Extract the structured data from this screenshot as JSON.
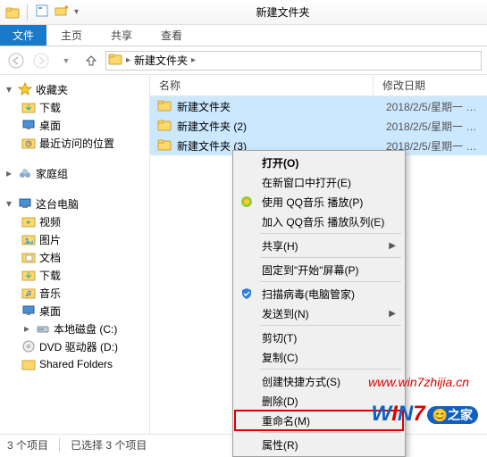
{
  "window": {
    "title": "新建文件夹"
  },
  "tabs": {
    "file": "文件",
    "home": "主页",
    "share": "共享",
    "view": "查看"
  },
  "address": {
    "root": "新建文件夹"
  },
  "columns": {
    "name": "名称",
    "date": "修改日期"
  },
  "files": [
    {
      "name": "新建文件夹",
      "date": "2018/2/5/星期一 …",
      "selected": true
    },
    {
      "name": "新建文件夹 (2)",
      "date": "2018/2/5/星期一 …",
      "selected": true
    },
    {
      "name": "新建文件夹 (3)",
      "date": "2018/2/5/星期一 …",
      "selected": true
    }
  ],
  "sidebar": {
    "favorites": "收藏夹",
    "downloads": "下载",
    "desktop": "桌面",
    "recent": "最近访问的位置",
    "homegroup": "家庭组",
    "thispc": "这台电脑",
    "videos": "视频",
    "pictures": "图片",
    "documents": "文档",
    "downloads2": "下载",
    "music": "音乐",
    "desktop2": "桌面",
    "localdisk": "本地磁盘 (C:)",
    "dvd": "DVD 驱动器 (D:)",
    "shared": "Shared Folders"
  },
  "status": {
    "items": "3 个项目",
    "selected": "已选择 3 个项目"
  },
  "ctx": {
    "open": "打开(O)",
    "open_new": "在新窗口中打开(E)",
    "qq_play": "使用 QQ音乐 播放(P)",
    "qq_queue": "加入 QQ音乐 播放队列(E)",
    "share": "共享(H)",
    "pin_start": "固定到\"开始\"屏幕(P)",
    "scan": "扫描病毒(电脑管家)",
    "send_to": "发送到(N)",
    "cut": "剪切(T)",
    "copy": "复制(C)",
    "shortcut": "创建快捷方式(S)",
    "delete": "删除(D)",
    "rename": "重命名(M)",
    "properties": "属性(R)"
  },
  "watermark": {
    "url": "www.win7zhijia.cn"
  }
}
